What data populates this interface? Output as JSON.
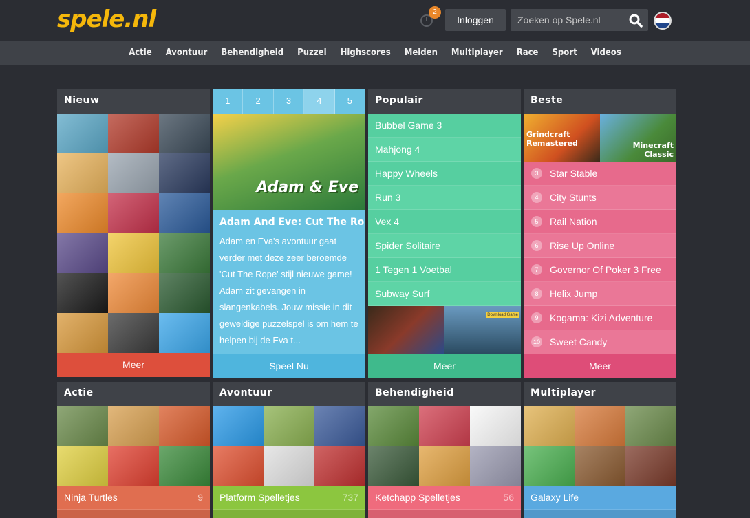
{
  "header": {
    "logo": "spele.nl",
    "notification_count": "2",
    "login_label": "Inloggen",
    "search_placeholder": "Zoeken op Spele.nl"
  },
  "nav": [
    "Actie",
    "Avontuur",
    "Behendigheid",
    "Puzzel",
    "Highscores",
    "Meiden",
    "Multiplayer",
    "Race",
    "Sport",
    "Videos"
  ],
  "nieuw": {
    "title": "Nieuw",
    "more": "Meer",
    "tile_colors": [
      "#5aa7c6",
      "#b23a2a",
      "#3b4a58",
      "#e8b35c",
      "#9aa5b0",
      "#2a3a5e",
      "#ee8a2a",
      "#c4304a",
      "#2a5a9a",
      "#5a4a8a",
      "#f0c53a",
      "#3b7a3a",
      "#1a1a1a",
      "#ef8a38",
      "#2a5a30",
      "#d8983a",
      "#3a3a3a",
      "#3aa6ea"
    ]
  },
  "featured": {
    "tabs": [
      "1",
      "2",
      "3",
      "4",
      "5"
    ],
    "active_tab": "4",
    "title": "Adam And Eve: Cut The Ro...",
    "description": "Adam en Eva's avontuur gaat verder met deze zeer beroemde 'Cut The Rope' stijl nieuwe game! Adam zit gevangen in slangenkabels. Jouw missie in dit geweldige puzzelspel is om hem te helpen bij de Eva t...",
    "play": "Speel Nu"
  },
  "populair": {
    "title": "Populair",
    "items": [
      "Bubbel Game 3",
      "Mahjong 4",
      "Happy Wheels",
      "Run 3",
      "Vex 4",
      "Spider Solitaire",
      "1 Tegen 1 Voetbal",
      "Subway Surf"
    ],
    "more": "Meer",
    "download_label": "Download Game"
  },
  "beste": {
    "title": "Beste",
    "top_games": [
      "Grindcraft Remastered",
      "Minecraft Classic"
    ],
    "items": [
      {
        "rank": "3",
        "name": "Star Stable"
      },
      {
        "rank": "4",
        "name": "City Stunts"
      },
      {
        "rank": "5",
        "name": "Rail Nation"
      },
      {
        "rank": "6",
        "name": "Rise Up Online"
      },
      {
        "rank": "7",
        "name": "Governor Of Poker 3 Free"
      },
      {
        "rank": "8",
        "name": "Helix Jump"
      },
      {
        "rank": "9",
        "name": "Kogama: Kizi Adventure"
      },
      {
        "rank": "10",
        "name": "Sweet Candy"
      }
    ],
    "more": "Meer"
  },
  "categories": [
    {
      "title": "Actie",
      "row": "Ninja Turtles",
      "count": "9",
      "color": "#e06e50",
      "tiles": [
        "#6a8a4a",
        "#d8a050",
        "#d85a2a",
        "#e0d040",
        "#e04030",
        "#3a8a3a"
      ]
    },
    {
      "title": "Avontuur",
      "row": "Platform Spelletjes",
      "count": "737",
      "color": "#8cc63f",
      "tiles": [
        "#2a9ae8",
        "#8ab050",
        "#3a5a9a",
        "#e05030",
        "#e0e0e0",
        "#c03030"
      ]
    },
    {
      "title": "Behendigheid",
      "row": "Ketchapp Spelletjes",
      "count": "56",
      "color": "#ef6b7d",
      "tiles": [
        "#5a8a3a",
        "#d04050",
        "#f8f8f8",
        "#3a5a3a",
        "#e0a040",
        "#9a9ab0"
      ]
    },
    {
      "title": "Multiplayer",
      "row": "Galaxy Life",
      "count": "",
      "color": "#5aa9e0",
      "tiles": [
        "#e0b050",
        "#d87a3a",
        "#6a8a4a",
        "#4ab050",
        "#8a5a30",
        "#7a3a2a"
      ]
    }
  ]
}
